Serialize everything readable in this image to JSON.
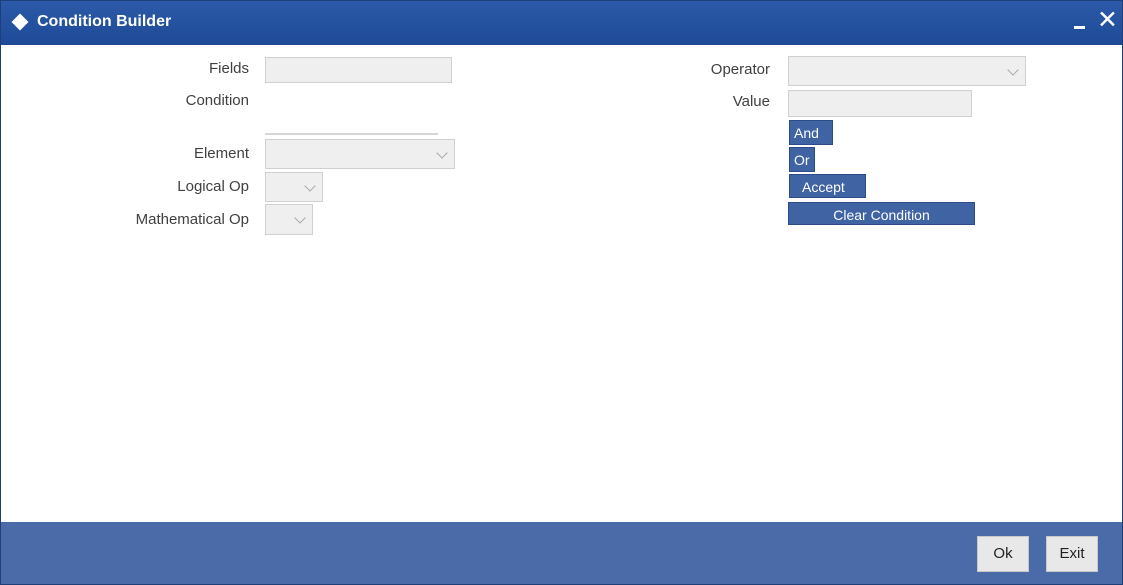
{
  "window": {
    "title": "Condition Builder"
  },
  "controls": {
    "close_glyph": "✕"
  },
  "left": {
    "fields_label": "Fields",
    "fields_value": "",
    "condition_label": "Condition",
    "element_label": "Element",
    "element_value": "",
    "logical_label": "Logical Op",
    "logical_value": "",
    "mathematical_label": "Mathematical Op",
    "mathematical_value": ""
  },
  "right": {
    "operator_label": "Operator",
    "operator_value": "",
    "value_label": "Value",
    "value_value": "",
    "and_label": "And",
    "or_label": "Or",
    "accept_label": "Accept",
    "clear_label": "Clear Condition"
  },
  "footer": {
    "ok_label": "Ok",
    "exit_label": "Exit"
  },
  "colors": {
    "titlebar": "#1e4a97",
    "button": "#3f63a3",
    "footer": "#4b6ba8"
  },
  "icons": {
    "title": "diamond-icon",
    "minimize": "minimize-icon",
    "close": "close-icon",
    "dropdown": "chevron-down-icon"
  }
}
